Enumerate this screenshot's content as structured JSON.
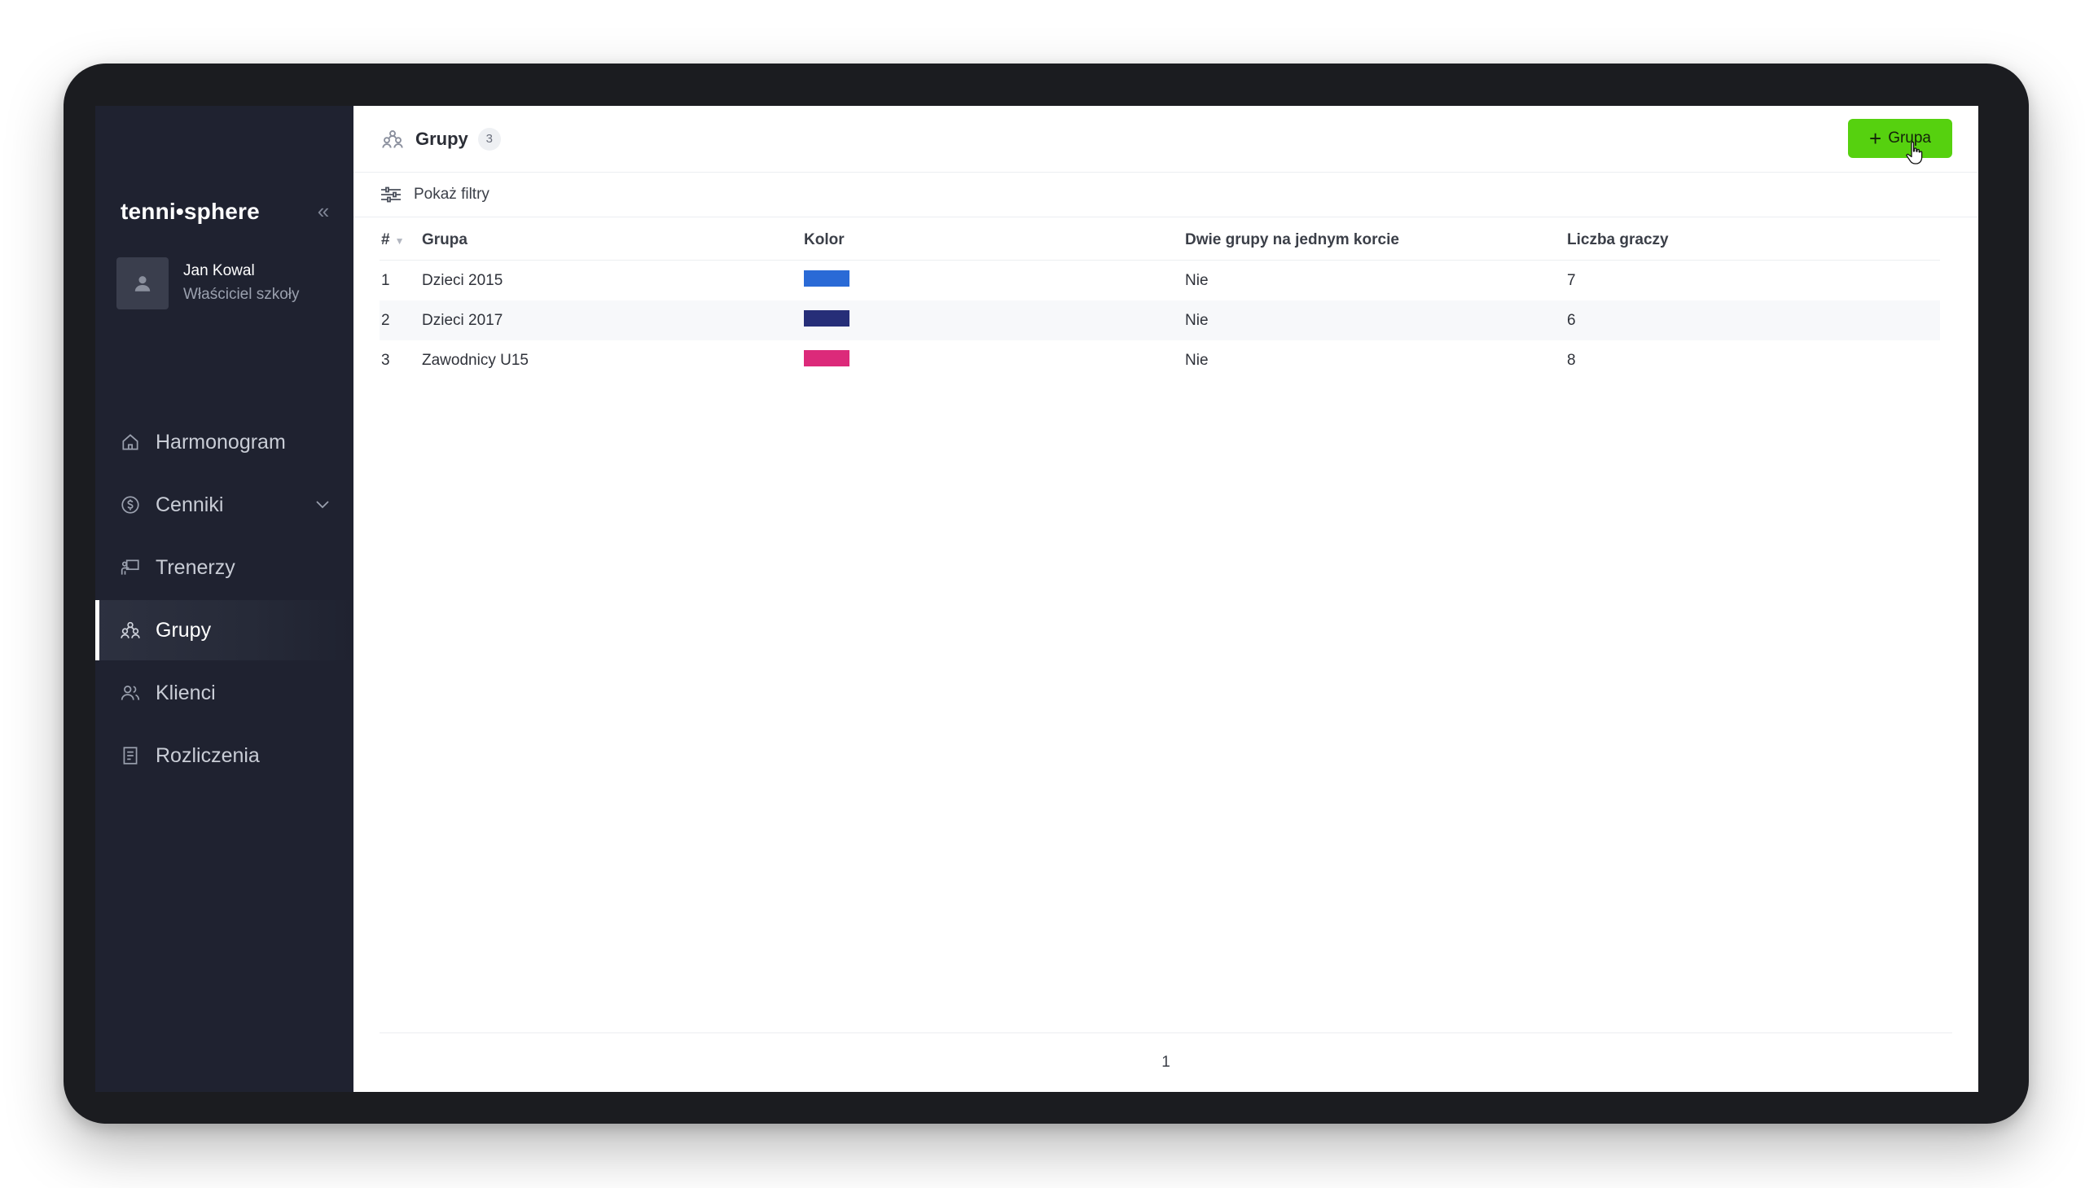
{
  "sidebar": {
    "brand": "tenni•sphere",
    "collapse_icon": "double-chevron-left-icon",
    "user": {
      "name": "Jan Kowal",
      "role": "Właściciel szkoły"
    },
    "items": [
      {
        "label": "Harmonogram",
        "icon": "home-icon",
        "active": false
      },
      {
        "label": "Cenniki",
        "icon": "dollar-circle-icon",
        "active": false,
        "expandable": true
      },
      {
        "label": "Trenerzy",
        "icon": "trainer-board-icon",
        "active": false
      },
      {
        "label": "Grupy",
        "icon": "groups-icon",
        "active": true
      },
      {
        "label": "Klienci",
        "icon": "users-icon",
        "active": false
      },
      {
        "label": "Rozliczenia",
        "icon": "receipt-icon",
        "active": false
      }
    ]
  },
  "header": {
    "title": "Grupy",
    "count": "3",
    "add_button": "Grupa"
  },
  "filters": {
    "toggle_label": "Pokaż filtry"
  },
  "table": {
    "columns": [
      "#",
      "Grupa",
      "Kolor",
      "Dwie grupy na jednym korcie",
      "Liczba graczy"
    ],
    "rows": [
      {
        "idx": "1",
        "name": "Dzieci 2015",
        "color": "#2a6ad6",
        "two_groups": "Nie",
        "players": "7"
      },
      {
        "idx": "2",
        "name": "Dzieci 2017",
        "color": "#262e78",
        "two_groups": "Nie",
        "players": "6"
      },
      {
        "idx": "3",
        "name": "Zawodnicy U15",
        "color": "#dc2a7a",
        "two_groups": "Nie",
        "players": "8"
      }
    ]
  },
  "pagination": {
    "current_page": "1"
  },
  "colors": {
    "accent": "#56d10f",
    "sidebar_bg": "#1f2230"
  }
}
